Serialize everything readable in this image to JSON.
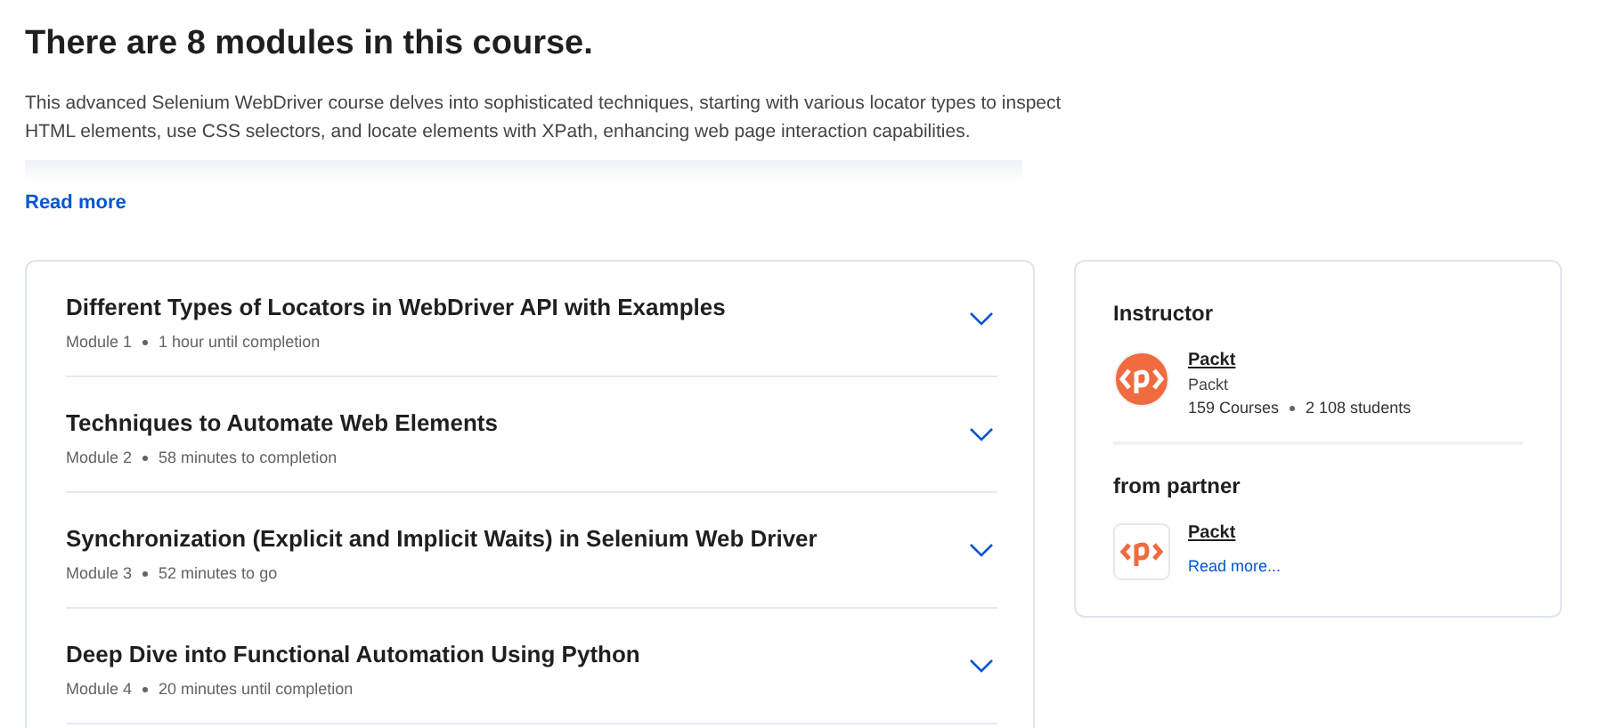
{
  "heading": "There are 8 modules in this course.",
  "description": "This advanced Selenium WebDriver course delves into sophisticated techniques, starting with various locator types to inspect HTML elements, use CSS selectors, and locate elements with XPath, enhancing web page interaction capabilities.",
  "read_more": "Read more",
  "modules": [
    {
      "title": "Different Types of Locators in WebDriver API with Examples",
      "module": "Module 1",
      "duration": "1 hour until completion",
      "expanded": false
    },
    {
      "title": "Techniques to Automate Web Elements",
      "module": "Module 2",
      "duration": "58 minutes to completion",
      "expanded": false
    },
    {
      "title": "Synchronization (Explicit and Implicit Waits) in Selenium Web Driver",
      "module": "Module 3",
      "duration": "52 minutes to go",
      "expanded": false
    },
    {
      "title": "Deep Dive into Functional Automation Using Python",
      "module": "Module 4",
      "duration": "20 minutes until completion",
      "expanded": false
    }
  ],
  "instructor": {
    "heading": "Instructor",
    "name": "Packt",
    "organization": "Packt",
    "courses": "159 Courses",
    "students": "2 108 students"
  },
  "partner": {
    "heading": "from partner",
    "name": "Packt",
    "read_more": "Read more..."
  }
}
